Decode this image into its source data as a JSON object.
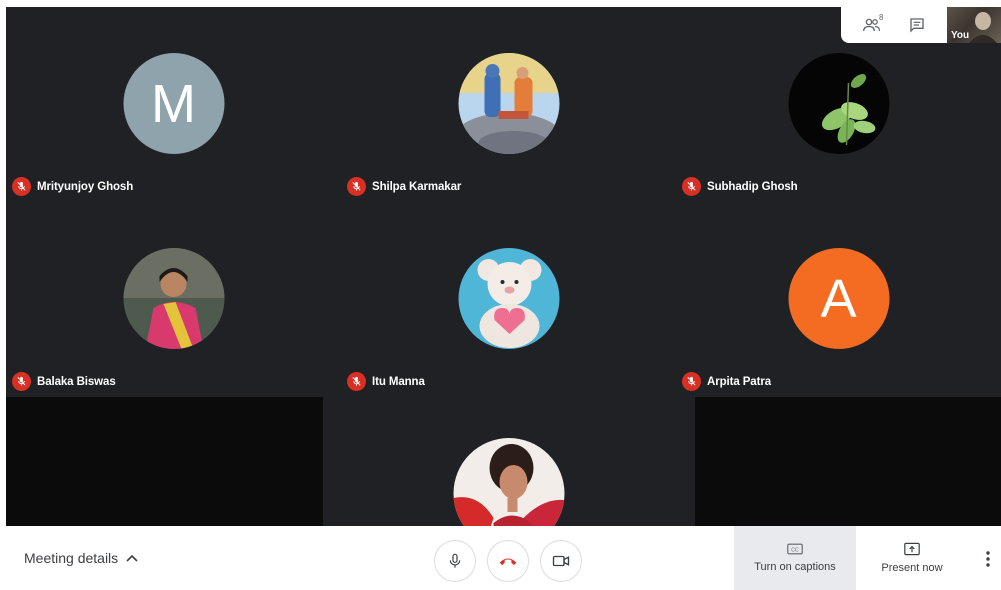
{
  "participants": [
    {
      "name": "Mrityunjoy Ghosh",
      "avatar_letter": "M",
      "avatar_color": "#8fa3ad"
    },
    {
      "name": "Shilpa Karmakar"
    },
    {
      "name": "Subhadip Ghosh"
    },
    {
      "name": "Balaka Biswas"
    },
    {
      "name": "Itu Manna"
    },
    {
      "name": "Arpita Patra",
      "avatar_letter": "A",
      "avatar_color": "#f36c21"
    }
  ],
  "top_bar": {
    "participant_count": "8",
    "self_label": "You"
  },
  "bottom_bar": {
    "meeting_details_label": "Meeting details",
    "captions_label": "Turn on captions",
    "present_label": "Present now"
  },
  "colors": {
    "stage_bg": "#202124",
    "mic_off": "#d93025",
    "hangup": "#d93025"
  }
}
